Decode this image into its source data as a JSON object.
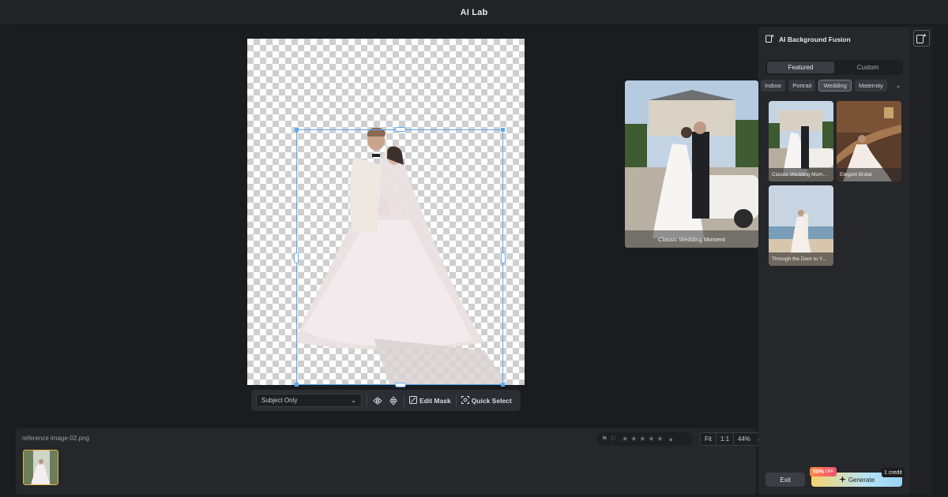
{
  "app": {
    "title": "AI Lab"
  },
  "toolbar": {
    "mode_select": "Subject Only",
    "edit_mask_label": "Edit Mask",
    "quick_select_label": "Quick Select"
  },
  "preview": {
    "caption": "Classic Wedding Moment"
  },
  "filmstrip": {
    "filename": "reference image-02.png",
    "rating_stars": 0,
    "zoom": {
      "fit": "Fit",
      "one_to_one": "1:1",
      "level": "44%"
    }
  },
  "panel": {
    "title": "AI Background Fusion",
    "tabs": [
      {
        "label": "Featured",
        "active": true
      },
      {
        "label": "Custom",
        "active": false
      }
    ],
    "categories": [
      {
        "label": "Indoor",
        "active": false
      },
      {
        "label": "Portrait",
        "active": false
      },
      {
        "label": "Wedding",
        "active": true
      },
      {
        "label": "Maternity",
        "active": false
      }
    ],
    "cards": [
      {
        "caption": "Classic Wedding Mom..."
      },
      {
        "caption": "Elegant Bridal"
      },
      {
        "caption": "Through the Door to Y..."
      }
    ],
    "exit_label": "Exit",
    "generate_label": "Generate",
    "discount_label": "50%",
    "discount_suffix": "OFF",
    "credit_label": "1 credit"
  },
  "colors": {
    "accent_selection": "#5aa8f0",
    "thumb_border": "#e0b341",
    "background": "#1b1d20",
    "panel": "#25272b"
  }
}
